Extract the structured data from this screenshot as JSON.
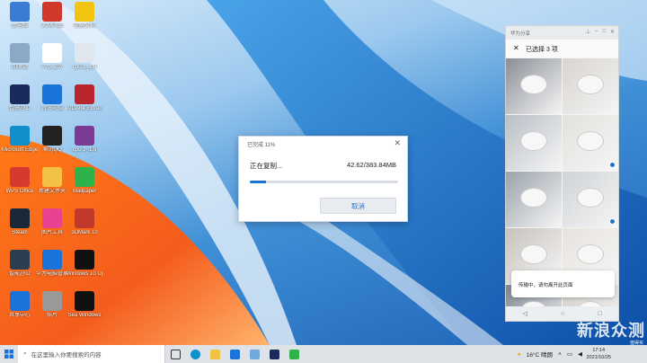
{
  "desktop_icons": [
    {
      "label": "此电脑",
      "icon": "computer-icon",
      "color": "#3a7bd5"
    },
    {
      "label": "JCMPEB",
      "icon": "app-icon",
      "color": "#d0392b"
    },
    {
      "label": "提醒文档",
      "icon": "document-icon",
      "color": "#f1c40f"
    },
    {
      "label": "回收站",
      "icon": "recycle-bin-icon",
      "color": "#8aa9c6"
    },
    {
      "label": "V?b_20?",
      "icon": "file-icon",
      "color": "#ffffff"
    },
    {
      "label": "cpu-z_1.9",
      "icon": "file-icon",
      "color": "#dfe6ee"
    },
    {
      "label": "智慧办公",
      "icon": "app-icon",
      "color": "#1a2a5a"
    },
    {
      "label": "腾讯电脑",
      "icon": "shield-icon",
      "color": "#1a73d9"
    },
    {
      "label": "AIDA64 Extreme",
      "icon": "aida-icon",
      "color": "#b8262c"
    },
    {
      "label": "Microsoft Edge",
      "icon": "edge-icon",
      "color": "#0f8fcc"
    },
    {
      "label": "腾讯QQ",
      "icon": "qq-icon",
      "color": "#222222"
    },
    {
      "label": "cpu-z_1.9",
      "icon": "archive-icon",
      "color": "#7a3b95"
    },
    {
      "label": "WPS Office",
      "icon": "wps-icon",
      "color": "#d63a2f"
    },
    {
      "label": "新建文件夹",
      "icon": "folder-icon",
      "color": "#f3c244"
    },
    {
      "label": "Wallpaper",
      "icon": "app-icon",
      "color": "#2db34a"
    },
    {
      "label": "Steam",
      "icon": "steam-icon",
      "color": "#1b2838"
    },
    {
      "label": "图片工具",
      "icon": "color-icon",
      "color": "#e84393"
    },
    {
      "label": "3DMark 10",
      "icon": "3dmark-icon",
      "color": "#c0392b"
    },
    {
      "label": "智能办公",
      "icon": "monitor-icon",
      "color": "#2c3e50"
    },
    {
      "label": "华为电脑管家",
      "icon": "huawei-icon",
      "color": "#1a73d9"
    },
    {
      "label": "Windows 10 Update",
      "icon": "circle-icon",
      "color": "#111111"
    },
    {
      "label": "共享中心",
      "icon": "app-icon",
      "color": "#1a73d9"
    },
    {
      "label": "照片",
      "icon": "image-icon",
      "color": "#999999"
    },
    {
      "label": "Sea Windows",
      "icon": "cat-icon",
      "color": "#111111"
    }
  ],
  "copy_dialog": {
    "title": "已完成 11%",
    "status": "正在复制...",
    "size": "42.62/383.84MB",
    "progress": 0.11,
    "cancel_label": "取消",
    "accent": "#1a73d9"
  },
  "phone": {
    "window_title": "华为分享",
    "header": "已选择 3 项",
    "toast": "传输中，请勿离开此页面",
    "checked_indices": [
      3,
      5,
      7
    ]
  },
  "taskbar": {
    "search_placeholder": "在这里输入你要搜索的内容",
    "weather": "16°C 晴朗",
    "time": "17:14",
    "date": "2021/10/25"
  },
  "watermark": {
    "text": "新浪众测",
    "sub": "值得买"
  }
}
